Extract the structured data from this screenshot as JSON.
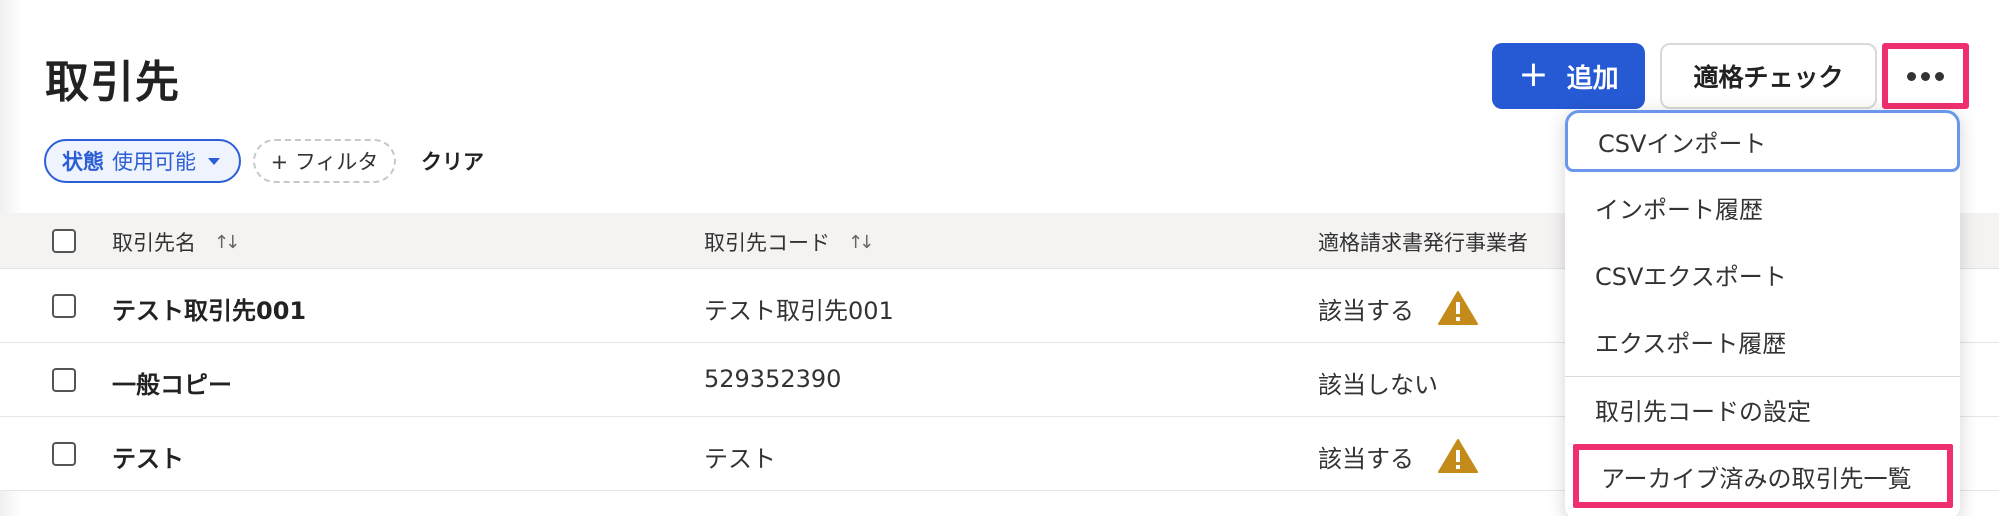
{
  "page": {
    "title": "取引先"
  },
  "header": {
    "add_label": "追加",
    "check_label": "適格チェック"
  },
  "filters": {
    "status_key": "状態",
    "status_value": "使用可能",
    "add_filter_label": "+ フィルタ",
    "clear_label": "クリア"
  },
  "table": {
    "columns": [
      "取引先名",
      "取引先コード",
      "適格請求書発行事業者"
    ],
    "rows": [
      {
        "name": "テスト取引先001",
        "code": "テスト取引先001",
        "qualified": "該当する",
        "warning": true
      },
      {
        "name": "一般コピー",
        "code": "529352390",
        "qualified": "該当しない",
        "warning": false
      },
      {
        "name": "テスト",
        "code": "テスト",
        "qualified": "該当する",
        "warning": true
      }
    ]
  },
  "menu": {
    "items": [
      "CSVインポート",
      "インポート履歴",
      "CSVエクスポート",
      "エクスポート履歴",
      "取引先コードの設定",
      "アーカイブ済みの取引先一覧"
    ]
  },
  "colors": {
    "primary": "#2659d4",
    "highlight": "#f0306e",
    "warning": "#c48a1a"
  }
}
